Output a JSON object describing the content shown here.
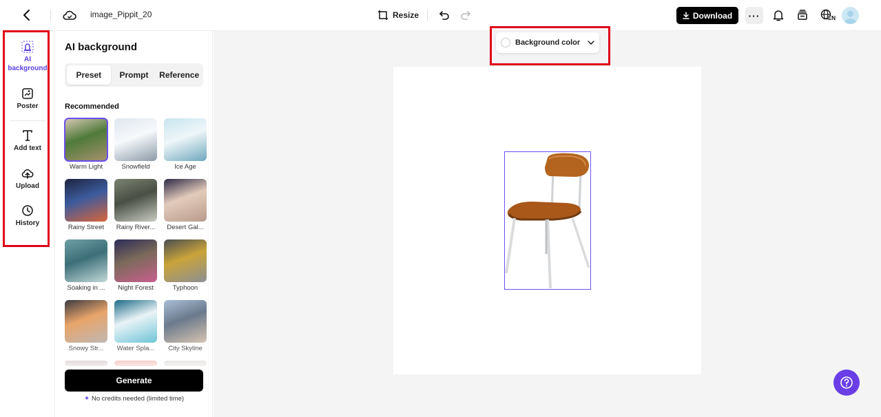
{
  "topbar": {
    "filename": "image_Pippit_20",
    "resize_label": "Resize",
    "download_label": "Download",
    "more_label": "···",
    "lang_badge": "EN"
  },
  "sidebar": {
    "items": [
      {
        "label": "AI background",
        "icon": "ai-background-icon",
        "active": true
      },
      {
        "label": "Poster",
        "icon": "poster-icon"
      },
      {
        "label": "Add text",
        "icon": "text-icon"
      },
      {
        "label": "Upload",
        "icon": "upload-icon"
      },
      {
        "label": "History",
        "icon": "history-icon"
      }
    ]
  },
  "panel": {
    "title": "AI background",
    "tabs": [
      "Preset",
      "Prompt",
      "Reference"
    ],
    "active_tab": "Preset",
    "section_label": "Recommended",
    "presets": [
      {
        "label": "Warm Light",
        "colors": [
          "#d8c9b6",
          "#a8916f",
          "#4f7a3a"
        ],
        "selected": true
      },
      {
        "label": "Snowfield",
        "colors": [
          "#dfe6ee",
          "#8c9aa8",
          "#f7f9fb"
        ]
      },
      {
        "label": "Ice Age",
        "colors": [
          "#c7e4ee",
          "#6fa7bd",
          "#eef6f8"
        ]
      },
      {
        "label": "Rainy Street",
        "colors": [
          "#1e2440",
          "#d9643a",
          "#3c5b9d"
        ]
      },
      {
        "label": "Rainy River...",
        "colors": [
          "#7b8370",
          "#c8ccc2",
          "#4a4f45"
        ]
      },
      {
        "label": "Desert Gal...",
        "colors": [
          "#2d2a45",
          "#b89a8c",
          "#e3cbbb"
        ]
      },
      {
        "label": "Soaking in ...",
        "colors": [
          "#6f9ea6",
          "#c2d9d8",
          "#3d6f78"
        ]
      },
      {
        "label": "Night Forest",
        "colors": [
          "#2a2b57",
          "#c85f8e",
          "#7b6a5a"
        ]
      },
      {
        "label": "Typhoon",
        "colors": [
          "#4a4d52",
          "#8c8f94",
          "#c9a43a"
        ]
      },
      {
        "label": "Snowy Str...",
        "colors": [
          "#3b3a40",
          "#bfb8b3",
          "#e8a46a"
        ]
      },
      {
        "label": "Water Spla...",
        "colors": [
          "#1c6a86",
          "#6fc4d8",
          "#e9f3f6"
        ]
      },
      {
        "label": "City Skyline",
        "colors": [
          "#a9bfd8",
          "#d8c4b2",
          "#6b7a8c"
        ]
      }
    ],
    "generate_label": "Generate",
    "credits_note": "No credits needed (limited time)"
  },
  "canvas": {
    "bg_color_label": "Background color"
  }
}
